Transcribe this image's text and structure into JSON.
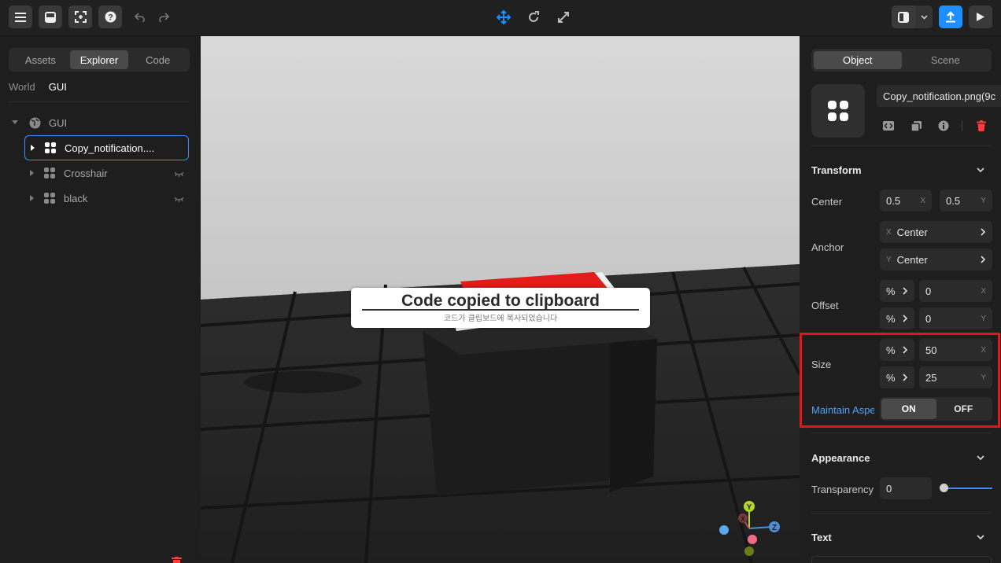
{
  "toolbar": {
    "left_icons": [
      "menu-icon",
      "inbox-icon",
      "capture-icon",
      "help-icon",
      "undo-icon",
      "redo-icon"
    ],
    "center_icons": [
      "move-icon",
      "rotate-icon",
      "scale-icon"
    ],
    "right_icons": [
      "layout-icon",
      "chevron-down-icon",
      "publish-icon",
      "play-icon"
    ],
    "accent": "#1e8fff"
  },
  "left_panel": {
    "tabs": [
      "Assets",
      "Explorer",
      "Code"
    ],
    "active_tab": "Explorer",
    "subtabs": [
      "World",
      "GUI"
    ],
    "tree": {
      "root": "GUI",
      "items": [
        {
          "label": "Copy_notification....",
          "selected": true
        },
        {
          "label": "Crosshair",
          "selected": false
        },
        {
          "label": "black",
          "selected": false
        }
      ]
    }
  },
  "viewport": {
    "toast_title": "Code copied to clipboard",
    "toast_subtitle": "코드가 클립보드에 복사되었습니다",
    "gizmo_labels": {
      "y": "Y",
      "x": "X",
      "z": "Z"
    }
  },
  "right_panel": {
    "tabs": [
      "Object",
      "Scene"
    ],
    "active_tab": "Object",
    "object_name": "Copy_notification.png(9c",
    "transform": {
      "title": "Transform",
      "center_label": "Center",
      "center_x": "0.5",
      "center_y": "0.5",
      "anchor_label": "Anchor",
      "anchor_x": "Center",
      "anchor_y": "Center",
      "offset_label": "Offset",
      "offset_x_unit": "%",
      "offset_x": "0",
      "offset_y_unit": "%",
      "offset_y": "0",
      "size_label": "Size",
      "size_x_unit": "%",
      "size_x": "50",
      "size_y_unit": "%",
      "size_y": "25",
      "aspect_label": "Maintain Aspe",
      "aspect_on": "ON",
      "aspect_off": "OFF"
    },
    "appearance": {
      "title": "Appearance",
      "transparency_label": "Transparency",
      "transparency_value": "0",
      "transparency_level": 0
    },
    "text": {
      "title": "Text"
    },
    "axis": {
      "x": "X",
      "y": "Y"
    }
  },
  "colors": {
    "highlight": "#e8141a",
    "link": "#4da3ff",
    "delete": "#ff3b3b"
  }
}
